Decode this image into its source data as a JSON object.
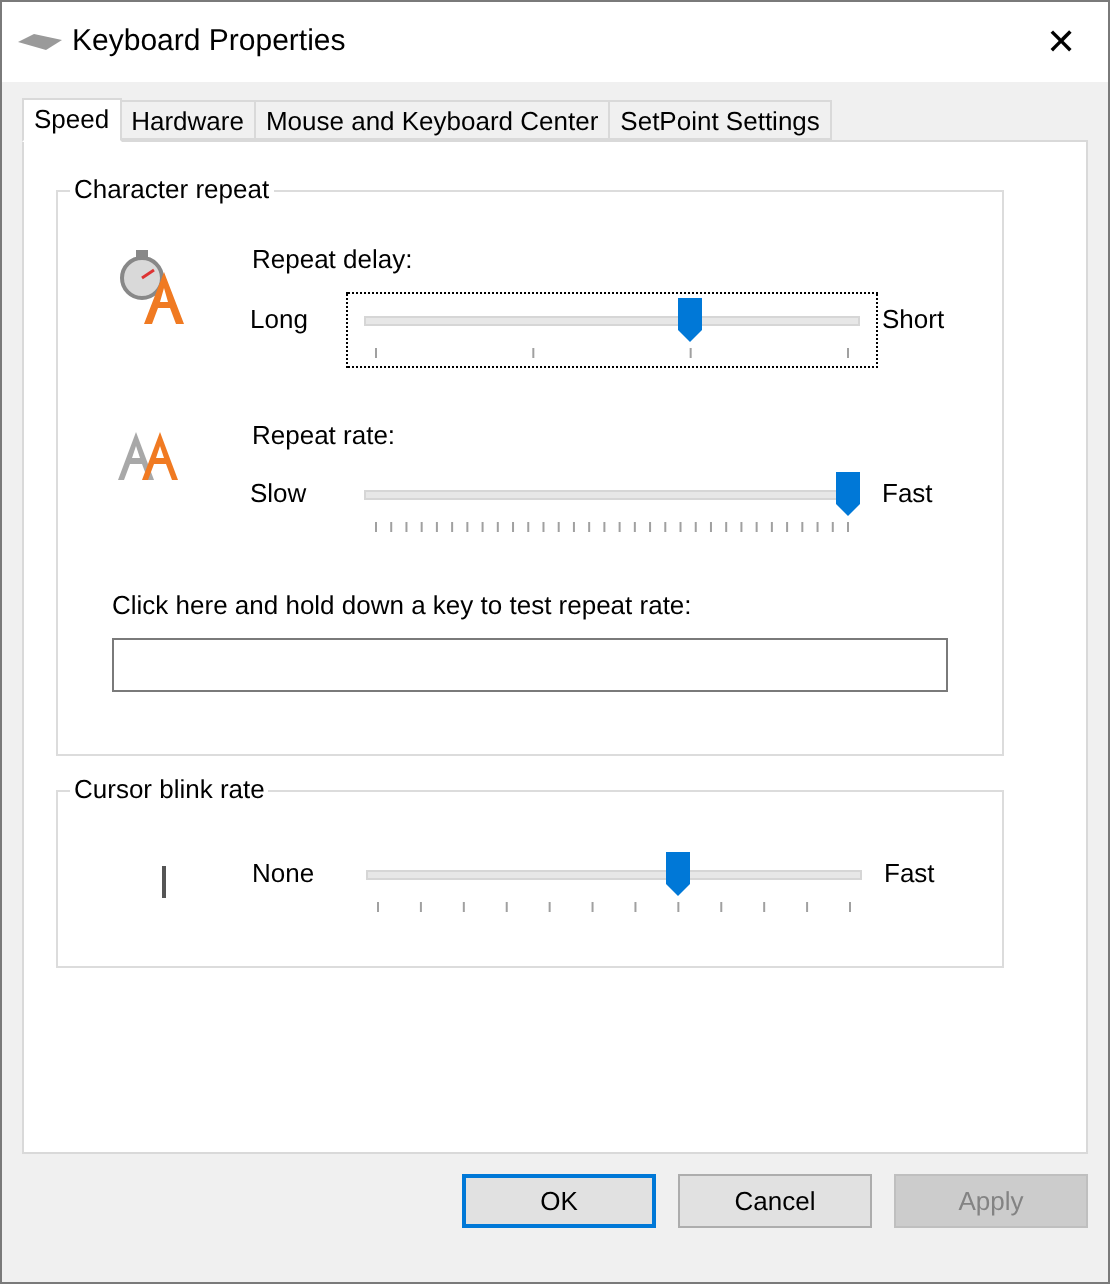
{
  "window": {
    "title": "Keyboard Properties",
    "close": "✕"
  },
  "tabs": [
    {
      "label": "Speed",
      "selected": true
    },
    {
      "label": "Hardware",
      "selected": false
    },
    {
      "label": "Mouse and Keyboard Center",
      "selected": false
    },
    {
      "label": "SetPoint Settings",
      "selected": false
    }
  ],
  "character_repeat": {
    "title": "Character repeat",
    "sliders": [
      {
        "kind": "delay",
        "label": "Repeat delay:",
        "min_label": "Long",
        "max_label": "Short",
        "level": 0.667,
        "focused": true
      },
      {
        "kind": "rate",
        "label": "Repeat rate:",
        "min_label": "Slow",
        "max_label": "Fast",
        "level": 1,
        "focused": false
      }
    ],
    "test_prompt": "Click here and hold down a key to test repeat rate:"
  },
  "cursor_blink": {
    "title": "Cursor blink rate",
    "min_label": "None",
    "max_label": "Fast",
    "level": 0.636
  },
  "buttons": [
    {
      "label": "OK",
      "default": true,
      "disabled": false
    },
    {
      "label": "Cancel",
      "default": false,
      "disabled": false
    },
    {
      "label": "Apply",
      "default": false,
      "disabled": true
    }
  ]
}
